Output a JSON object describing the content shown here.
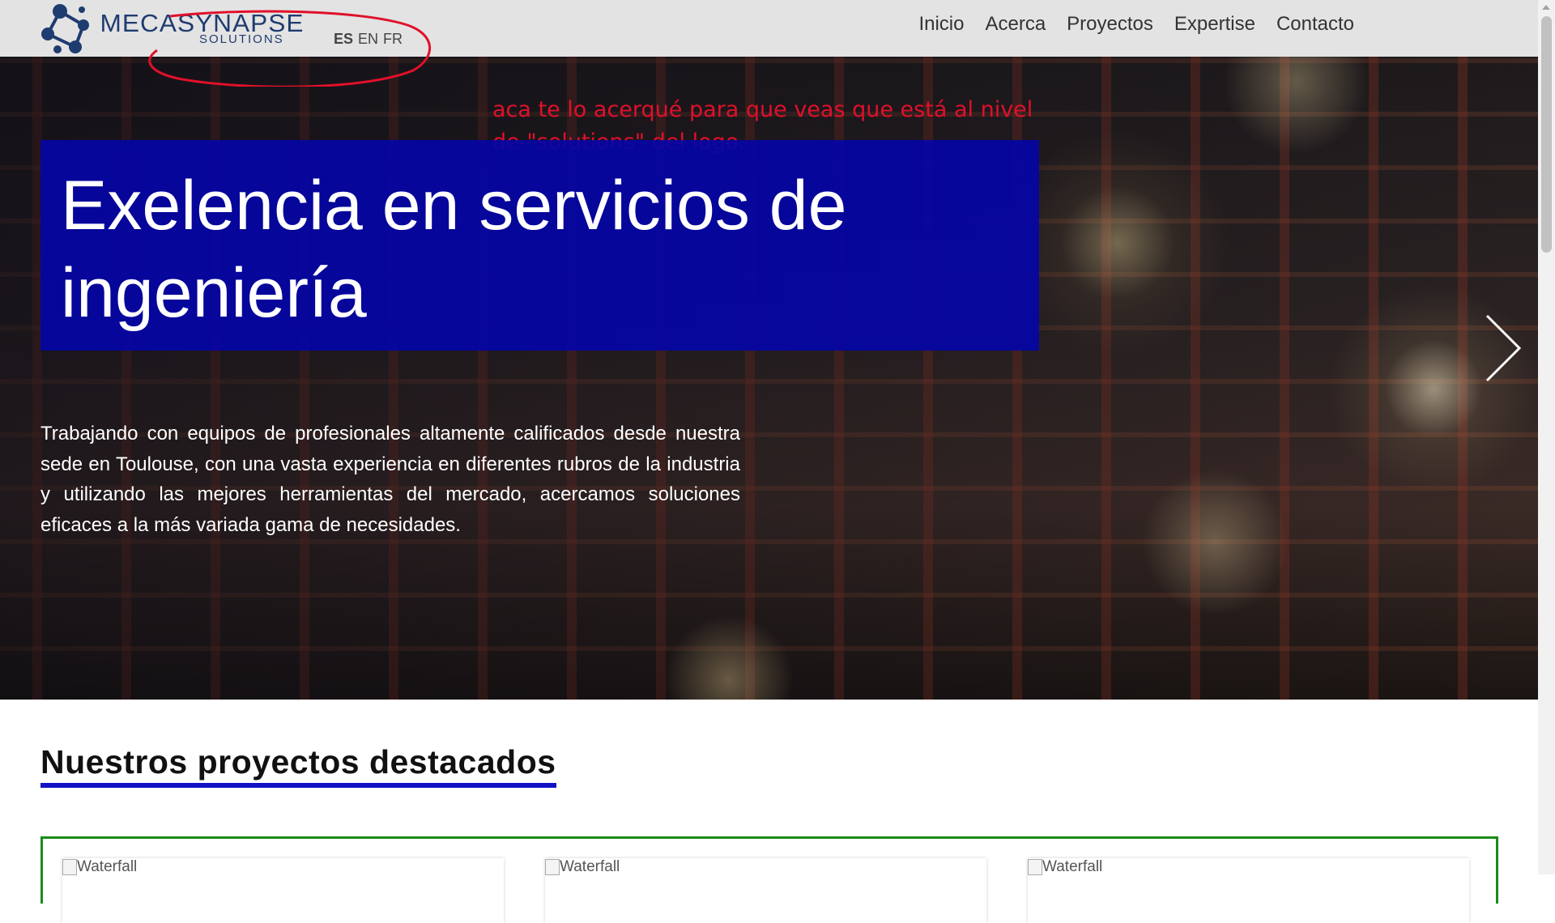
{
  "brand": {
    "name": "MECASYNAPSE",
    "sub": "SOLUTIONS"
  },
  "languages": [
    {
      "label": "ES",
      "active": true
    },
    {
      "label": "EN",
      "active": false
    },
    {
      "label": "FR",
      "active": false
    }
  ],
  "nav": [
    "Inicio",
    "Acerca",
    "Proyectos",
    "Expertise",
    "Contacto"
  ],
  "annotation": "aca te lo acerqué para que veas que está al nivel de \"solutions\" del logo.",
  "hero": {
    "title": "Exelencia en servicios de ingeniería",
    "text": "Trabajando con equipos de profesionales altamente calificados desde nuestra sede en Toulouse, con una vasta experiencia en diferentes rubros de la industria y utilizando las mejores herramientas del mercado, acercamos soluciones eficaces a la más variada gama de necesidades."
  },
  "section": {
    "title": "Nuestros proyectos destacados"
  },
  "projects": [
    {
      "alt": "Waterfall"
    },
    {
      "alt": "Waterfall"
    },
    {
      "alt": "Waterfall"
    }
  ],
  "colors": {
    "accent": "#0505a5",
    "underline": "#1212c4",
    "annotation": "#e0102a",
    "card_border": "#1a8c1a",
    "logo": "#1f3c70"
  }
}
